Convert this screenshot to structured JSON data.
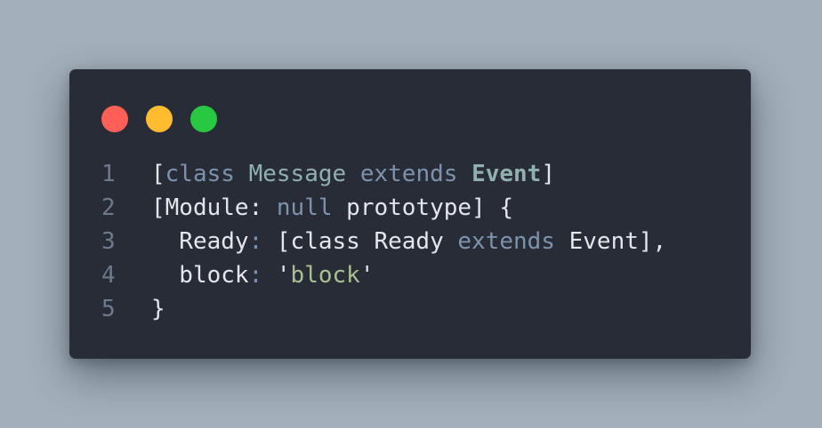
{
  "window": {
    "controls": [
      {
        "name": "close-button",
        "color": "#ff5f57"
      },
      {
        "name": "minimize-button",
        "color": "#febc2e"
      },
      {
        "name": "maximize-button",
        "color": "#28c840"
      }
    ]
  },
  "code": {
    "lines": [
      {
        "number": "1",
        "tokens": [
          {
            "text": "[",
            "type": "pun"
          },
          {
            "text": "class",
            "type": "kw"
          },
          {
            "text": " ",
            "type": "pun"
          },
          {
            "text": "Message",
            "type": "cls"
          },
          {
            "text": " ",
            "type": "pun"
          },
          {
            "text": "extends",
            "type": "kw"
          },
          {
            "text": " ",
            "type": "pun"
          },
          {
            "text": "Event",
            "type": "clsb"
          },
          {
            "text": "]",
            "type": "pun"
          }
        ]
      },
      {
        "number": "2",
        "tokens": [
          {
            "text": "[Module",
            "type": "pun"
          },
          {
            "text": ":",
            "type": "pun"
          },
          {
            "text": " ",
            "type": "pun"
          },
          {
            "text": "null",
            "type": "kw"
          },
          {
            "text": " prototype] {",
            "type": "pun"
          }
        ]
      },
      {
        "number": "3",
        "tokens": [
          {
            "text": "  Ready",
            "type": "pun"
          },
          {
            "text": ":",
            "type": "colon"
          },
          {
            "text": " [class Ready ",
            "type": "pun"
          },
          {
            "text": "extends",
            "type": "kw"
          },
          {
            "text": " Event],",
            "type": "pun"
          }
        ]
      },
      {
        "number": "4",
        "tokens": [
          {
            "text": "  block",
            "type": "pun"
          },
          {
            "text": ":",
            "type": "colon"
          },
          {
            "text": " '",
            "type": "pun"
          },
          {
            "text": "block",
            "type": "str"
          },
          {
            "text": "'",
            "type": "pun"
          }
        ]
      },
      {
        "number": "5",
        "tokens": [
          {
            "text": "}",
            "type": "pun"
          }
        ]
      }
    ]
  }
}
